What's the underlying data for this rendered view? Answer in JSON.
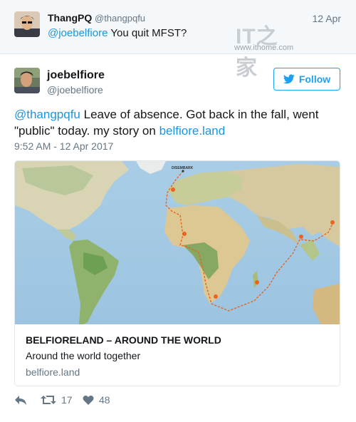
{
  "parent_tweet": {
    "name": "ThangPQ",
    "handle": "@thangpqfu",
    "date": "12 Apr",
    "mention": "@joebelfiore",
    "text": " You quit MFST?"
  },
  "watermark": {
    "logo": "IT之家",
    "site": "www.ithome.com"
  },
  "tweet": {
    "author_name": "joebelfiore",
    "author_handle": "@joebelfiore",
    "follow_label": "Follow",
    "mention": "@thangpqfu",
    "text_line1": " Leave of absence. Got back in the fall, went",
    "text_line2": "\"public\" today. my story on ",
    "link": "belfiore.land",
    "timestamp": "9:52 AM - 12 Apr 2017"
  },
  "card": {
    "map_label": "DISEMBARK",
    "title": "BELFIORELAND – AROUND THE WORLD",
    "description": "Around the world together",
    "domain": "belfiore.land"
  },
  "actions": {
    "reply_icon": "reply-icon",
    "retweet_icon": "retweet-icon",
    "like_icon": "heart-icon",
    "retweets": "17",
    "likes": "48"
  },
  "colors": {
    "accent": "#1da1f2",
    "link": "#1b95e0",
    "muted": "#657786",
    "route": "#e8651f"
  }
}
